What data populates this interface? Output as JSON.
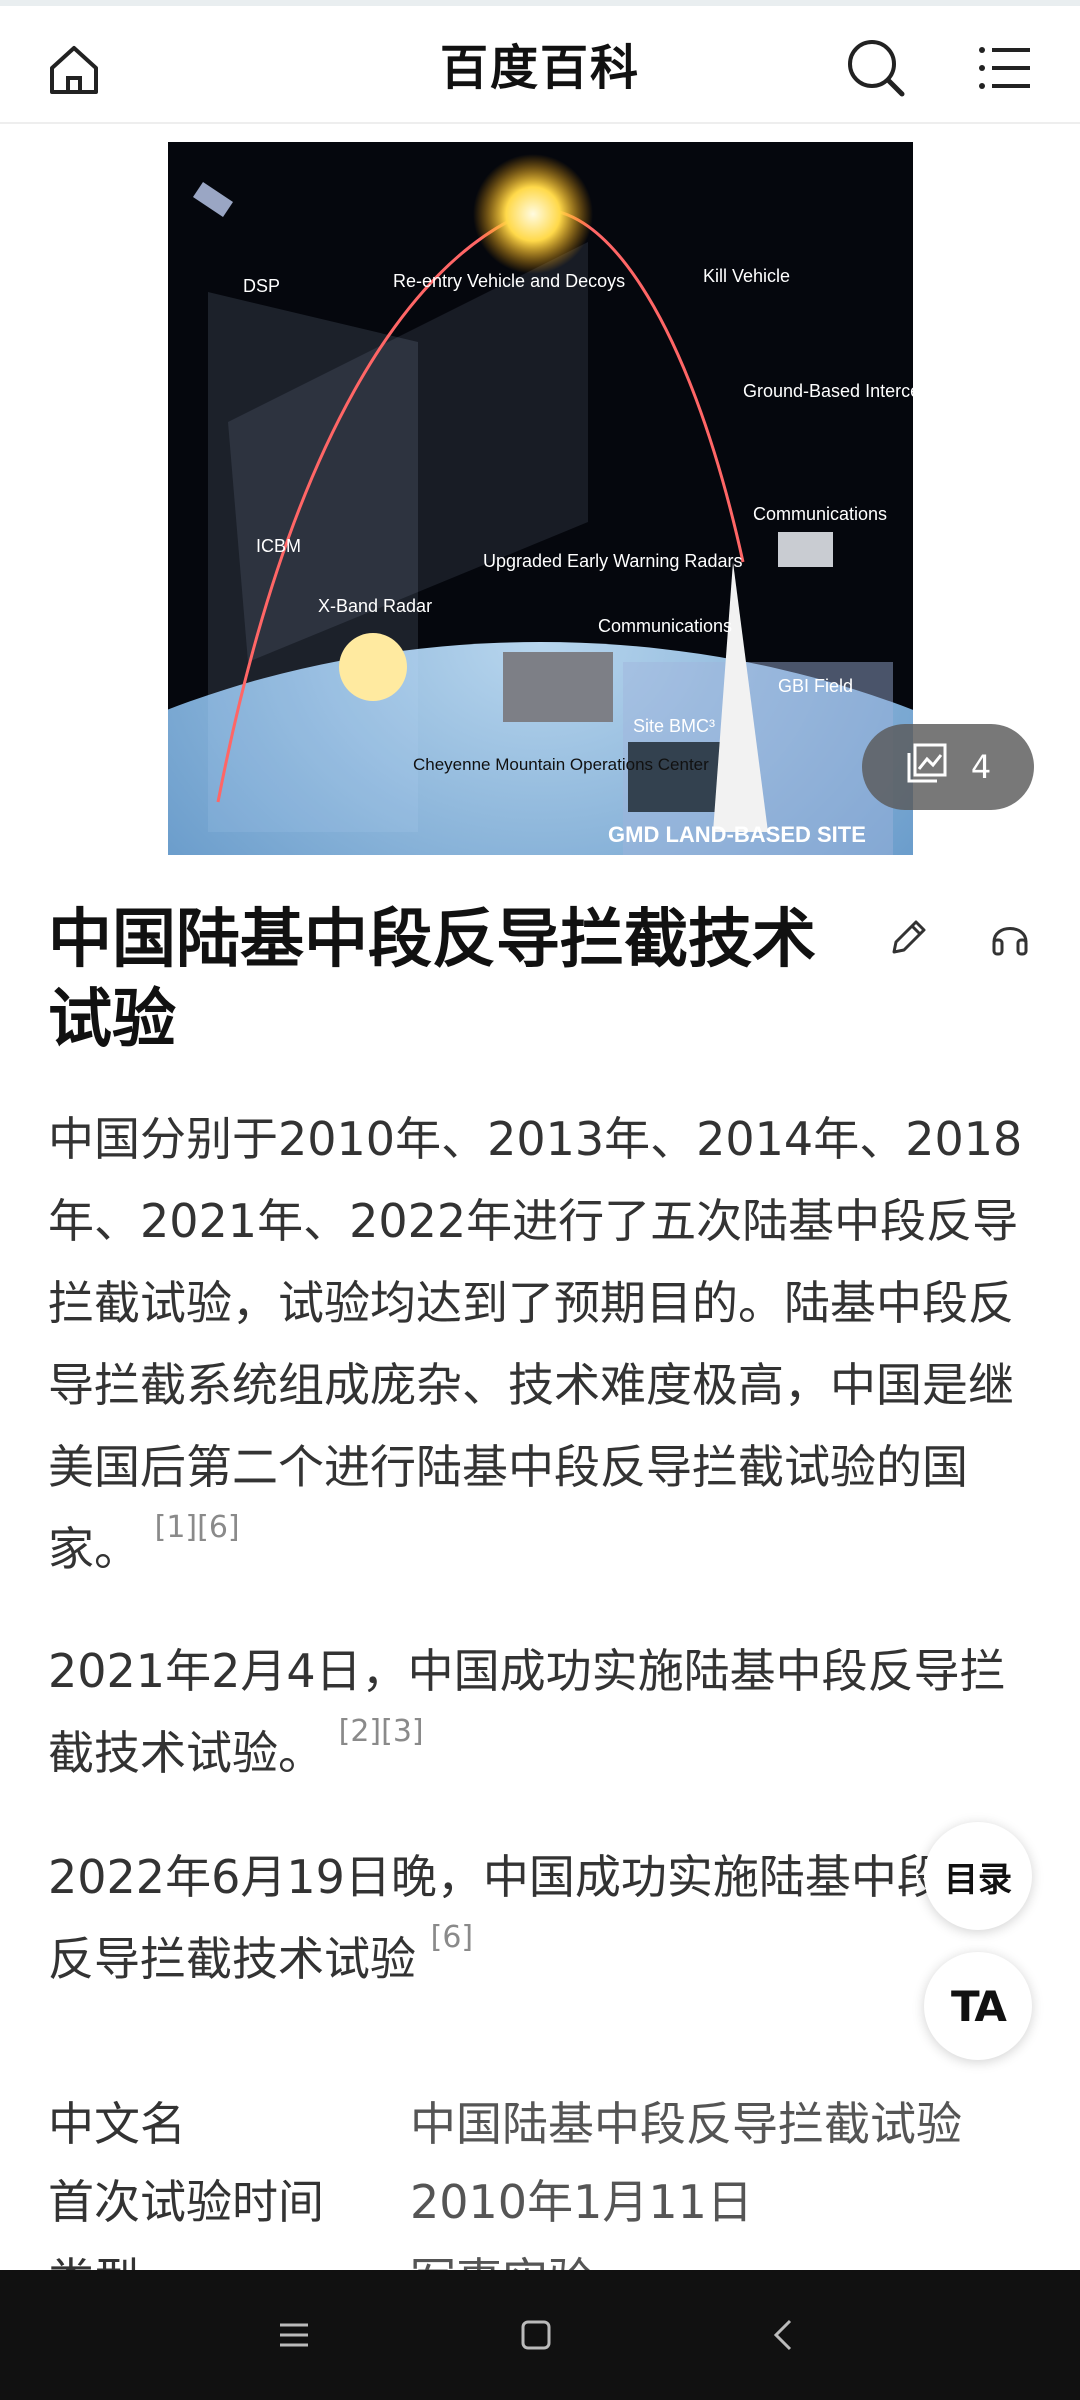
{
  "header": {
    "title": "百度百科",
    "icons": [
      "home-icon",
      "search-icon",
      "menu-icon"
    ]
  },
  "hero": {
    "gallery_count": "4",
    "image_labels": {
      "dsp": "DSP",
      "reentry": "Re-entry Vehicle and Decoys",
      "kill": "Kill Vehicle",
      "gbi": "Ground-Based Interceptor",
      "comm1": "Communications",
      "icbm": "ICBM",
      "radars": "Upgraded Early Warning Radars",
      "xband": "X-Band Radar",
      "comm2": "Communications",
      "gbifield": "GBI Field",
      "bmc": "Site BMC³",
      "cheyenne": "Cheyenne Mountain Operations Center",
      "site": "GMD LAND-BASED SITE"
    }
  },
  "article": {
    "title": "中国陆基中段反导拦截技术试验",
    "paragraphs": [
      {
        "text": "中国分别于2010年、2013年、2014年、2018年、2021年、2022年进行了五次陆基中段反导拦截试验，试验均达到了预期目的。陆基中段反导拦截系统组成庞杂、技术难度极高，中国是继美国后第二个进行陆基中段反导拦截试验的国家。",
        "ref": "[1][6]"
      },
      {
        "text": "2021年2月4日，中国成功实施陆基中段反导拦截技术试验。",
        "ref": "[2][3]"
      },
      {
        "text": "2022年6月19日晚，中国成功实施陆基中段反导拦截技术试验",
        "ref": "[6]"
      }
    ]
  },
  "info": [
    {
      "key": "中文名",
      "value": "中国陆基中段反导拦截试验"
    },
    {
      "key": "首次试验时间",
      "value": "2010年1月11日"
    },
    {
      "key": "类型",
      "value": "军事实验"
    }
  ],
  "floating": {
    "toc": "目录",
    "ta": "TA"
  },
  "colors": {
    "badge_bg": "#5a5a5a",
    "nav_bg": "#111111"
  }
}
